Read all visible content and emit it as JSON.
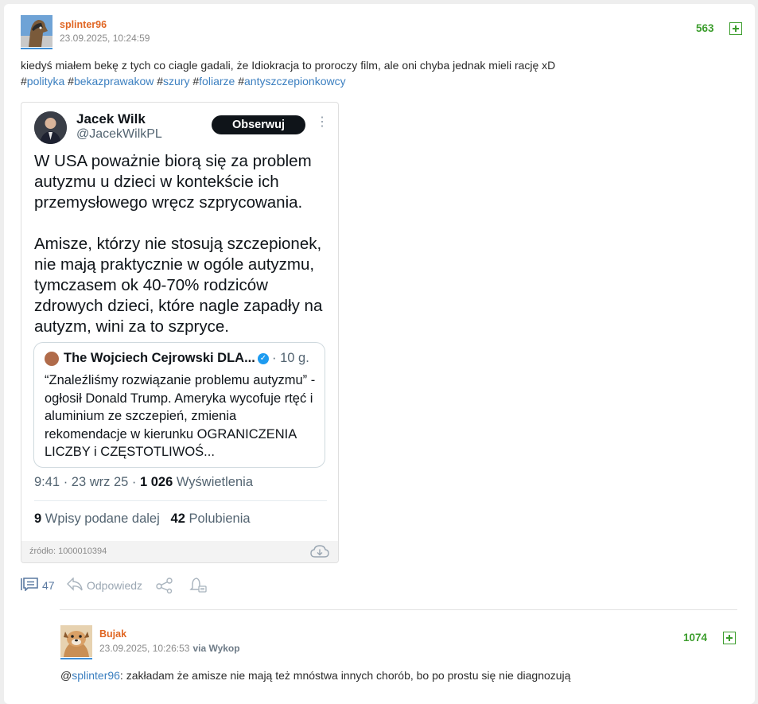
{
  "post": {
    "author": "splinter96",
    "timestamp": "23.09.2025, 10:24:59",
    "votes": "563",
    "text": "kiedyś miałem bekę z tych co ciagle gadali, że Idiokracja to proroczy film, ale oni chyba jednak mieli rację xD",
    "tags": [
      "polityka",
      "bekazprawakow",
      "szury",
      "foliarze",
      "antyszczepionkowcy"
    ],
    "comment_count": "47",
    "reply_label": "Odpowiedz"
  },
  "embed": {
    "name": "Jacek Wilk",
    "handle": "@JacekWilkPL",
    "follow_label": "Obserwuj",
    "text": "W USA poważnie biorą się za problem autyzmu u dzieci w kontekście ich przemysłowego wręcz szprycowania.\n\nAmisze, którzy nie stosują szczepionek, nie mają praktycznie w ogóle autyzmu, tymczasem ok 40-70% rodziców zdrowych dzieci, które nagle zapadły na autyzm, wini za to szpryce.",
    "quote": {
      "name": "The Wojciech Cejrowski DLA...",
      "time": "· 10 g.",
      "text": "“Znaleźliśmy rozwiązanie problemu autyzmu” - ogłosił Donald Trump. Ameryka wycofuje rtęć i aluminium ze szczepień, zmienia rekomendacje w kierunku OGRANICZENIA LICZBY i CZĘSTOTLIWOŚ..."
    },
    "meta_time": "9:41 · 23 wrz 25 · ",
    "views_count": "1 026",
    "views_label": " Wyświetlenia",
    "reposts_count": "9",
    "reposts_label": " Wpisy podane dalej",
    "likes_count": "42",
    "likes_label": " Polubienia",
    "source": "źródło: 1000010394"
  },
  "reply": {
    "author": "Bujak",
    "timestamp": "23.09.2025, 10:26:53",
    "via": "via Wykop",
    "votes": "1074",
    "mention": "splinter96",
    "text": ": zakładam że amisze nie mają też mnóstwa innych chorób, bo po prostu się nie diagnozują"
  },
  "colors": {
    "username": "#e06623",
    "votes": "#3c9d2d",
    "link": "#3b7fc0"
  }
}
